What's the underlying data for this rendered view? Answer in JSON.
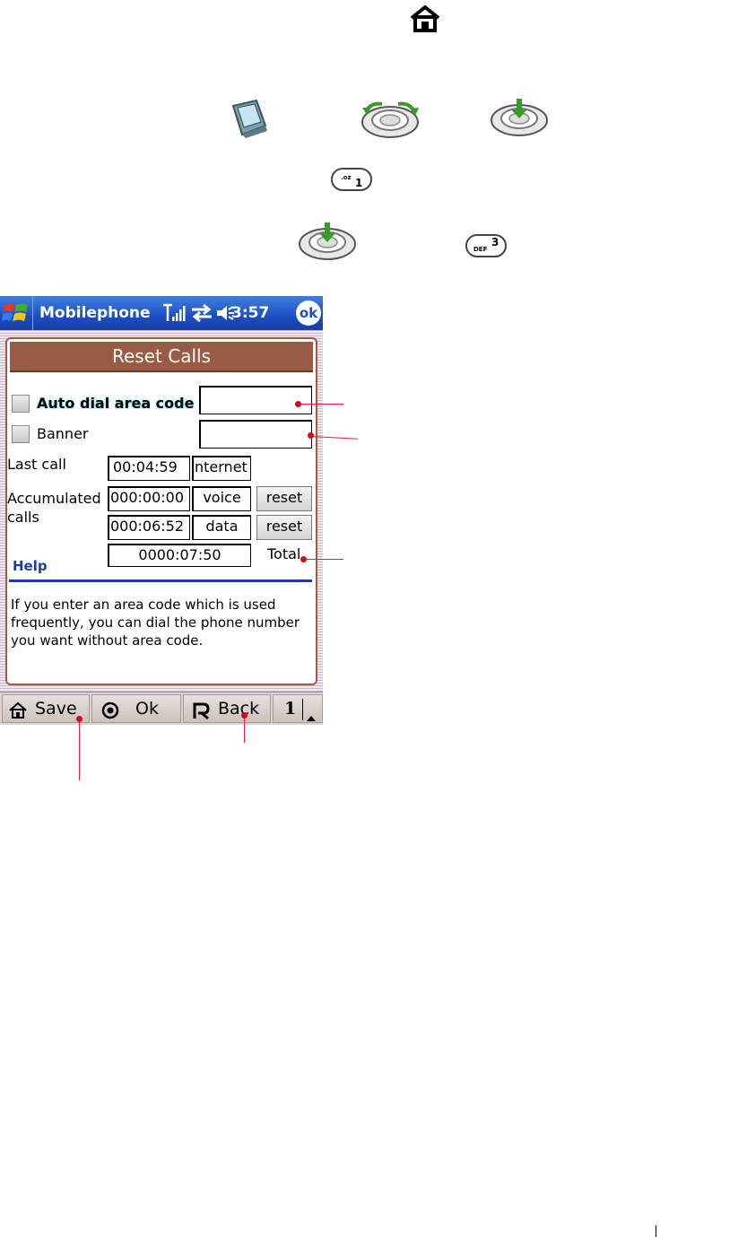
{
  "instructions": {
    "home_icon": "home-icon",
    "step_icons": [
      "phone-device-icon",
      "navigation-wheel-rotate-icon",
      "navigation-wheel-press-icon"
    ],
    "key_1": {
      "letters": ".oz",
      "digit": "1"
    },
    "key_3": {
      "letters": "DEF",
      "digit": "3"
    }
  },
  "taskbar": {
    "app_title": "Mobilephone",
    "clock": "3:57",
    "ok_label": "ok"
  },
  "screen": {
    "title": "Reset Calls",
    "auto_dial": {
      "label": "Auto dial area code",
      "checked": false,
      "value": ""
    },
    "banner": {
      "label": "Banner",
      "checked": false,
      "value": ""
    },
    "last_call": {
      "label": "Last call",
      "time": "00:04:59",
      "type": "nternet"
    },
    "accumulated": {
      "label_line1": "Accumulated",
      "label_line2": "calls",
      "voice": {
        "time": "000:00:00",
        "type": "voice",
        "reset_label": "reset"
      },
      "data": {
        "time": "000:06:52",
        "type": "data",
        "reset_label": "reset"
      },
      "total": {
        "time": "0000:07:50",
        "label": "Total"
      }
    },
    "help": {
      "title": "Help",
      "text": "If you enter an area code which is used frequently, you can dial the phone number you want without area code."
    }
  },
  "menubar": {
    "save_label": "Save",
    "ok_label": "Ok",
    "back_label": "Back",
    "page_label": "1"
  },
  "colors": {
    "taskbar": "#1c4fc2",
    "header": "#9a5b44",
    "help_blue": "#1a3fa0",
    "callout": "#e0204a"
  }
}
